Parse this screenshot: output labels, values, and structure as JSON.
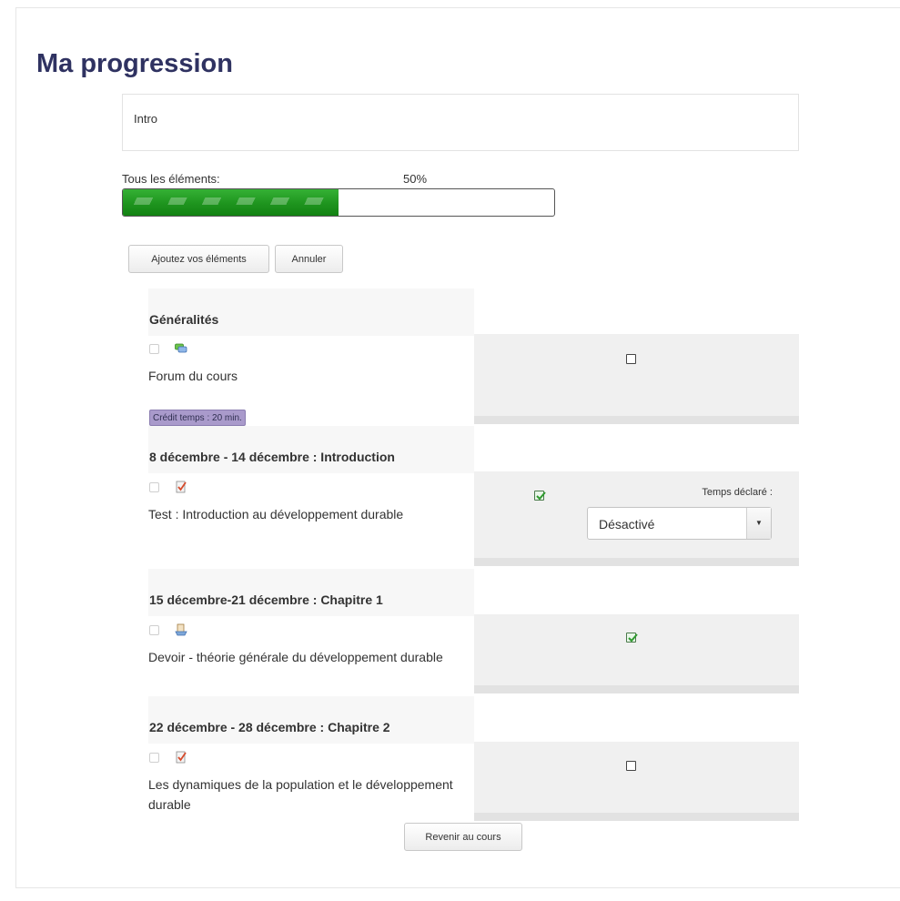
{
  "page_title": "Ma progression",
  "intro_text": "Intro",
  "progress": {
    "label": "Tous les éléments:",
    "percent_text": "50%",
    "value": 0.5
  },
  "toolbar": {
    "add_label": "Ajoutez vos éléments",
    "cancel_label": "Annuler"
  },
  "sections": [
    {
      "title": "Généralités",
      "activity": {
        "name": "Forum du cours",
        "icon": "forum-icon",
        "badge": "Crédit temps : 20 min.",
        "completion_checked": false
      }
    },
    {
      "title": "8 décembre - 14 décembre : Introduction",
      "activity": {
        "name": "Test : Introduction au développement durable",
        "icon": "quiz-icon",
        "completion_checked": true,
        "temps_label": "Temps déclaré :",
        "temps_value": "Désactivé"
      }
    },
    {
      "title": "15 décembre-21 décembre : Chapitre 1",
      "activity": {
        "name": "Devoir - théorie générale du développement durable",
        "icon": "assignment-icon",
        "completion_checked": true
      }
    },
    {
      "title": "22 décembre - 28 décembre : Chapitre 2",
      "activity": {
        "name": "Les dynamiques de la population et le développement durable",
        "icon": "quiz-icon",
        "completion_checked": false
      }
    }
  ],
  "back_button_label": "Revenir au cours",
  "colors": {
    "title": "#2f3261",
    "progress_fill": "#1e941e",
    "badge": "#a99acb",
    "cell_bg": "#f0f0f0"
  }
}
